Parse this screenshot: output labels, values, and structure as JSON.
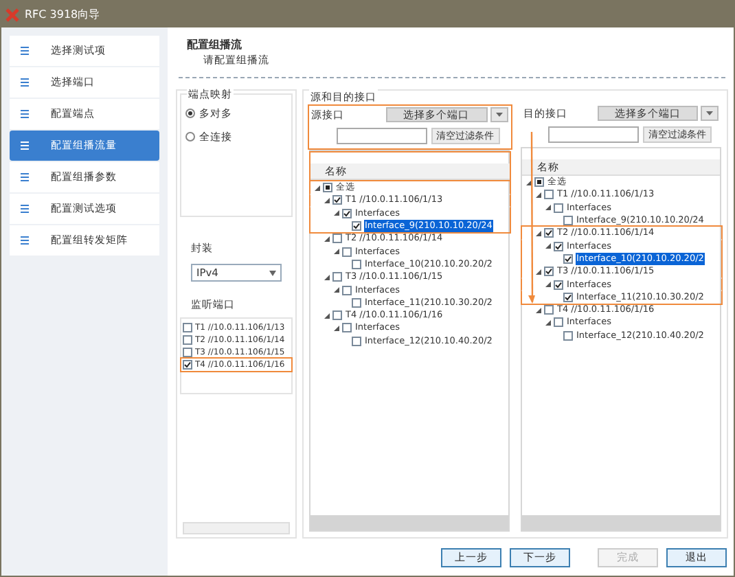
{
  "window": {
    "title": "RFC 3918向导"
  },
  "sidebar": {
    "items": [
      {
        "label": "选择测试项",
        "selected": false
      },
      {
        "label": "选择端口",
        "selected": false
      },
      {
        "label": "配置端点",
        "selected": false
      },
      {
        "label": "配置组播流量",
        "selected": true
      },
      {
        "label": "配置组播参数",
        "selected": false
      },
      {
        "label": "配置测试选项",
        "selected": false
      },
      {
        "label": "配置组转发矩阵",
        "selected": false
      }
    ]
  },
  "page": {
    "title": "配置组播流",
    "subtitle": "请配置组播流"
  },
  "endpoint_mapping": {
    "title": "端点映射",
    "options": [
      {
        "label": "多对多",
        "selected": true
      },
      {
        "label": "全连接",
        "selected": false
      }
    ]
  },
  "encapsulation": {
    "label": "封装",
    "value": "IPv4"
  },
  "listen_ports": {
    "label": "监听端口",
    "items": [
      {
        "label": "T1 //10.0.11.106/1/13",
        "checked": false,
        "highlighted": false
      },
      {
        "label": "T2 //10.0.11.106/1/14",
        "checked": false,
        "highlighted": false
      },
      {
        "label": "T3 //10.0.11.106/1/15",
        "checked": false,
        "highlighted": false
      },
      {
        "label": "T4 //10.0.11.106/1/16",
        "checked": true,
        "highlighted": true
      }
    ]
  },
  "interfaces": {
    "title": "源和目的接口",
    "panels": [
      {
        "label": "源接口",
        "button": "选择多个端口",
        "clear_button": "清空过滤条件",
        "column": "名称",
        "highlighted": true,
        "annotation_arrow": false,
        "select_all": {
          "label": "全选",
          "partial": true,
          "highlighted": true
        },
        "tree": [
          {
            "label": "T1 //10.0.11.106/1/13",
            "checked": true,
            "selected": false,
            "highlighted": true,
            "children": [
              {
                "label": "Interfaces",
                "checked": true,
                "selected": false,
                "highlighted": true,
                "children": [
                  {
                    "label": "Interface_9(210.10.10.20/24",
                    "checked": true,
                    "selected": true,
                    "highlighted": true
                  }
                ]
              }
            ]
          },
          {
            "label": "T2 //10.0.11.106/1/14",
            "checked": false,
            "selected": false,
            "highlighted": false,
            "children": [
              {
                "label": "Interfaces",
                "checked": false,
                "selected": false,
                "highlighted": false,
                "children": [
                  {
                    "label": "Interface_10(210.10.20.20/2",
                    "checked": false,
                    "selected": false,
                    "highlighted": false
                  }
                ]
              }
            ]
          },
          {
            "label": "T3 //10.0.11.106/1/15",
            "checked": false,
            "selected": false,
            "highlighted": false,
            "children": [
              {
                "label": "Interfaces",
                "checked": false,
                "selected": false,
                "highlighted": false,
                "children": [
                  {
                    "label": "Interface_11(210.10.30.20/2",
                    "checked": false,
                    "selected": false,
                    "highlighted": false
                  }
                ]
              }
            ]
          },
          {
            "label": "T4 //10.0.11.106/1/16",
            "checked": false,
            "selected": false,
            "highlighted": false,
            "children": [
              {
                "label": "Interfaces",
                "checked": false,
                "selected": false,
                "highlighted": false,
                "children": [
                  {
                    "label": "Interface_12(210.10.40.20/2",
                    "checked": false,
                    "selected": false,
                    "highlighted": false
                  }
                ]
              }
            ]
          }
        ]
      },
      {
        "label": "目的接口",
        "button": "选择多个端口",
        "clear_button": "清空过滤条件",
        "column": "名称",
        "highlighted": false,
        "annotation_arrow": true,
        "select_all": {
          "label": "全选",
          "partial": true,
          "highlighted": false
        },
        "tree": [
          {
            "label": "T1 //10.0.11.106/1/13",
            "checked": false,
            "selected": false,
            "highlighted": false,
            "children": [
              {
                "label": "Interfaces",
                "checked": false,
                "selected": false,
                "highlighted": false,
                "children": [
                  {
                    "label": "Interface_9(210.10.10.20/24",
                    "checked": false,
                    "selected": false,
                    "highlighted": false
                  }
                ]
              }
            ]
          },
          {
            "label": "T2 //10.0.11.106/1/14",
            "checked": true,
            "selected": false,
            "highlighted": true,
            "children": [
              {
                "label": "Interfaces",
                "checked": true,
                "selected": false,
                "highlighted": true,
                "children": [
                  {
                    "label": "Interface_10(210.10.20.20/2",
                    "checked": true,
                    "selected": true,
                    "highlighted": true
                  }
                ]
              }
            ]
          },
          {
            "label": "T3 //10.0.11.106/1/15",
            "checked": true,
            "selected": false,
            "highlighted": true,
            "children": [
              {
                "label": "Interfaces",
                "checked": true,
                "selected": false,
                "highlighted": true,
                "children": [
                  {
                    "label": "Interface_11(210.10.30.20/2",
                    "checked": true,
                    "selected": false,
                    "highlighted": true
                  }
                ]
              }
            ]
          },
          {
            "label": "T4 //10.0.11.106/1/16",
            "checked": false,
            "selected": false,
            "highlighted": false,
            "children": [
              {
                "label": "Interfaces",
                "checked": false,
                "selected": false,
                "highlighted": false,
                "children": [
                  {
                    "label": "Interface_12(210.10.40.20/2",
                    "checked": false,
                    "selected": false,
                    "highlighted": false
                  }
                ]
              }
            ]
          }
        ]
      }
    ]
  },
  "buttons": [
    {
      "label": "上一步",
      "disabled": false
    },
    {
      "label": "下一步",
      "disabled": false
    },
    {
      "label": "完成",
      "disabled": true
    },
    {
      "label": "退出",
      "disabled": false
    }
  ]
}
